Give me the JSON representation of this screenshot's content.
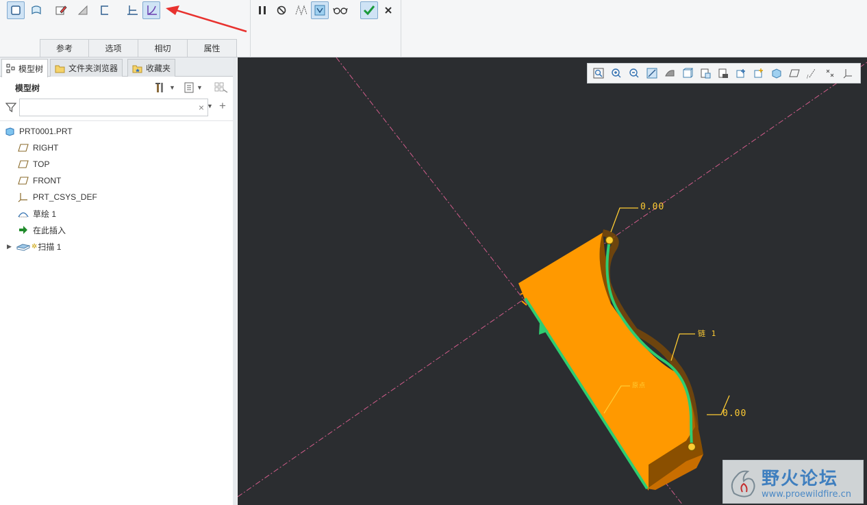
{
  "dashboard": {
    "tabs": [
      "参考",
      "选项",
      "相切",
      "属性"
    ],
    "buttons": {
      "solid": "solid-icon",
      "surface": "surface-icon",
      "sketch": "sketch-icon",
      "remove_material": "remove-material-icon",
      "thicken": "thicken-icon",
      "constant_section": "constant-section-icon",
      "variable_section": "variable-section-icon",
      "pause": "pause-icon",
      "no_preview": "no-preview-icon",
      "geometry_preview": "geometry-preview-icon",
      "verify": "verify-icon",
      "glasses": "glasses-icon",
      "ok": "check-icon",
      "cancel": "close-icon"
    }
  },
  "panel": {
    "tabs": [
      {
        "label": "模型树",
        "icon": "model-tree-icon"
      },
      {
        "label": "文件夹浏览器",
        "icon": "folder-browser-icon"
      },
      {
        "label": "收藏夹",
        "icon": "favorites-icon"
      }
    ],
    "title": "模型树",
    "search": {
      "value": "",
      "placeholder": ""
    },
    "tree": [
      {
        "label": "PRT0001.PRT",
        "icon": "part-icon",
        "level": 0
      },
      {
        "label": "RIGHT",
        "icon": "datum-plane-icon",
        "level": 1
      },
      {
        "label": "TOP",
        "icon": "datum-plane-icon",
        "level": 1
      },
      {
        "label": "FRONT",
        "icon": "datum-plane-icon",
        "level": 1
      },
      {
        "label": "PRT_CSYS_DEF",
        "icon": "csys-icon",
        "level": 1
      },
      {
        "label": "草绘 1",
        "icon": "sketch-feature-icon",
        "level": 1
      },
      {
        "label": "在此插入",
        "icon": "insert-here-arrow-icon",
        "level": 1
      },
      {
        "label": "扫描 1",
        "icon": "sweep-icon",
        "level": 1,
        "expandable": true
      }
    ]
  },
  "graphics": {
    "dimensions": [
      "0.00",
      "0.00"
    ],
    "labels": {
      "chain": "链 1",
      "origin": "原点"
    },
    "colors": {
      "background": "#2b2d30",
      "sweep": "#ff9900",
      "trajectory": "#2ecc71",
      "dimension": "#ffcc33",
      "datum": "#d35d8c"
    },
    "watermark": {
      "title": "野火论坛",
      "url": "www.proewildfire.cn"
    }
  }
}
